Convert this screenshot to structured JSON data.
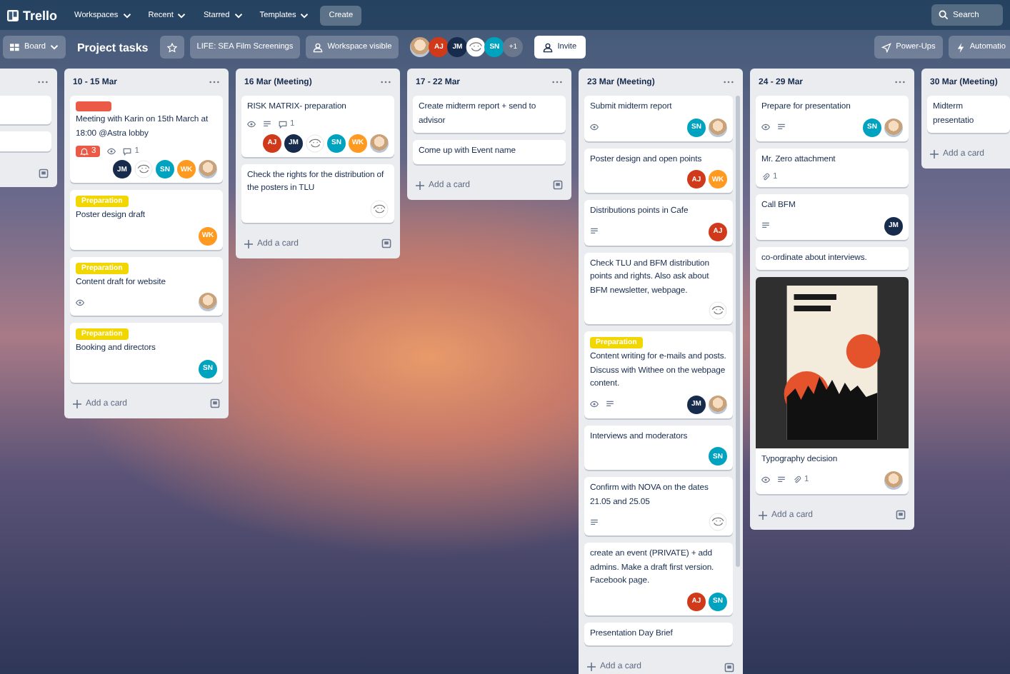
{
  "top_bar": {
    "logo": "Trello",
    "nav": [
      {
        "label": "Workspaces"
      },
      {
        "label": "Recent"
      },
      {
        "label": "Starred"
      },
      {
        "label": "Templates"
      }
    ],
    "create": "Create",
    "search": {
      "placeholder": "Search"
    }
  },
  "board_bar": {
    "view": "Board",
    "title": "Project tasks",
    "starred": false,
    "workspace": "LIFE: SEA Film Screenings",
    "visibility": "Workspace visible",
    "members": [
      {
        "kind": "photo"
      },
      {
        "kind": "initials",
        "text": "AJ",
        "color": "#d0391a"
      },
      {
        "kind": "initials",
        "text": "JM",
        "color": "#172b4d"
      },
      {
        "kind": "sketch"
      },
      {
        "kind": "initials",
        "text": "SN",
        "color": "#00a3bf"
      }
    ],
    "more_members": "+1",
    "invite": "Invite",
    "power_ups": "Power-Ups",
    "automation": "Automatio"
  },
  "lists": [
    {
      "kind": "clipped",
      "scrollable": false,
      "cards": [
        {
          "kind": "blank"
        },
        {
          "kind": "blank"
        }
      ]
    },
    {
      "kind": "full",
      "title": "10 - 15 Mar",
      "scrollable": false,
      "add_card": "Add a card",
      "cards": [
        {
          "kind": "task",
          "labels": [
            {
              "color": "#eb5a46"
            }
          ],
          "title": "Meeting with Karin on 15th March at 18:00 @Astra lobby",
          "badges": [
            {
              "kind": "notifications",
              "text": "3"
            },
            {
              "kind": "watch"
            },
            {
              "kind": "comments",
              "text": "1"
            }
          ],
          "members": [
            {
              "kind": "initials",
              "text": "JM",
              "color": "#172b4d"
            },
            {
              "kind": "sketch"
            },
            {
              "kind": "initials",
              "text": "SN",
              "color": "#00a3bf"
            },
            {
              "kind": "initials",
              "text": "WK",
              "color": "#ff991f"
            },
            {
              "kind": "photo"
            }
          ]
        },
        {
          "kind": "task",
          "labels": [
            {
              "text": "Preparation",
              "color": "#f2d600"
            }
          ],
          "title": "Poster design draft",
          "members": [
            {
              "kind": "initials",
              "text": "WK",
              "color": "#ff991f"
            }
          ]
        },
        {
          "kind": "task",
          "labels": [
            {
              "text": "Preparation",
              "color": "#f2d600"
            }
          ],
          "title": "Content draft for website",
          "badges": [
            {
              "kind": "watch"
            }
          ],
          "members": [
            {
              "kind": "photo"
            }
          ]
        },
        {
          "kind": "task",
          "labels": [
            {
              "text": "Preparation",
              "color": "#f2d600"
            }
          ],
          "title": "Booking and directors",
          "members": [
            {
              "kind": "initials",
              "text": "SN",
              "color": "#00a3bf"
            }
          ]
        }
      ]
    },
    {
      "kind": "full",
      "title": "16 Mar (Meeting)",
      "scrollable": false,
      "add_card": "Add a card",
      "cards": [
        {
          "kind": "task",
          "title": "RISK MATRIX- preparation",
          "badges": [
            {
              "kind": "watch"
            },
            {
              "kind": "description"
            },
            {
              "kind": "comments",
              "text": "1"
            }
          ],
          "members": [
            {
              "kind": "initials",
              "text": "AJ",
              "color": "#d0391a"
            },
            {
              "kind": "initials",
              "text": "JM",
              "color": "#172b4d"
            },
            {
              "kind": "sketch"
            },
            {
              "kind": "initials",
              "text": "SN",
              "color": "#00a3bf"
            },
            {
              "kind": "initials",
              "text": "WK",
              "color": "#ff991f"
            },
            {
              "kind": "photo"
            }
          ]
        },
        {
          "kind": "task",
          "title": "Check the rights for the distribution of the posters in TLU",
          "members": [
            {
              "kind": "sketch"
            }
          ]
        }
      ]
    },
    {
      "kind": "full",
      "title": "17 - 22 Mar",
      "scrollable": false,
      "add_card": "Add a card",
      "cards": [
        {
          "kind": "task",
          "title": "Create midterm report + send to advisor"
        },
        {
          "kind": "task",
          "title": "Come up with Event name"
        }
      ]
    },
    {
      "kind": "full",
      "title": "23 Mar (Meeting)",
      "scrollable": true,
      "add_card": "Add a card",
      "cards": [
        {
          "kind": "task",
          "title": "Submit midterm report",
          "badges": [
            {
              "kind": "watch"
            }
          ],
          "members": [
            {
              "kind": "initials",
              "text": "SN",
              "color": "#00a3bf"
            },
            {
              "kind": "photo"
            }
          ]
        },
        {
          "kind": "task",
          "title": "Poster design and open points",
          "members": [
            {
              "kind": "initials",
              "text": "AJ",
              "color": "#d0391a"
            },
            {
              "kind": "initials",
              "text": "WK",
              "color": "#ff991f"
            }
          ]
        },
        {
          "kind": "task",
          "title": "Distributions points in Cafe",
          "badges": [
            {
              "kind": "description"
            }
          ],
          "members": [
            {
              "kind": "initials",
              "text": "AJ",
              "color": "#d0391a"
            }
          ]
        },
        {
          "kind": "task",
          "title": "Check TLU and BFM distribution points and rights. Also ask about BFM newsletter, webpage.",
          "members": [
            {
              "kind": "sketch"
            }
          ]
        },
        {
          "kind": "task",
          "labels": [
            {
              "text": "Preparation",
              "color": "#f2d600"
            }
          ],
          "title": "Content writing for e-mails and posts. Discuss with Withee on the webpage content.",
          "badges": [
            {
              "kind": "watch"
            },
            {
              "kind": "description"
            }
          ],
          "members": [
            {
              "kind": "initials",
              "text": "JM",
              "color": "#172b4d"
            },
            {
              "kind": "photo"
            }
          ]
        },
        {
          "kind": "task",
          "title": "Interviews and moderators",
          "members": [
            {
              "kind": "initials",
              "text": "SN",
              "color": "#00a3bf"
            }
          ]
        },
        {
          "kind": "task",
          "title": "Confirm with NOVA on the dates 21.05 and 25.05",
          "badges": [
            {
              "kind": "description"
            }
          ],
          "members": [
            {
              "kind": "sketch"
            }
          ]
        },
        {
          "kind": "task",
          "title": "create an event (PRIVATE) + add admins. Make a draft first version. Facebook page.",
          "members": [
            {
              "kind": "initials",
              "text": "AJ",
              "color": "#d0391a"
            },
            {
              "kind": "initials",
              "text": "SN",
              "color": "#00a3bf"
            }
          ]
        },
        {
          "kind": "task",
          "title": "Presentation Day Brief"
        }
      ]
    },
    {
      "kind": "full",
      "title": "24 - 29 Mar",
      "scrollable": false,
      "add_card": "Add a card",
      "cards": [
        {
          "kind": "task",
          "title": "Prepare for presentation",
          "badges": [
            {
              "kind": "watch"
            },
            {
              "kind": "description"
            }
          ],
          "members": [
            {
              "kind": "initials",
              "text": "SN",
              "color": "#00a3bf"
            },
            {
              "kind": "photo"
            }
          ]
        },
        {
          "kind": "task",
          "title": "Mr. Zero attachment",
          "badges": [
            {
              "kind": "attachments",
              "text": "1"
            }
          ]
        },
        {
          "kind": "task",
          "title": "Call BFM",
          "badges": [
            {
              "kind": "description"
            }
          ],
          "members": [
            {
              "kind": "initials",
              "text": "JM",
              "color": "#172b4d"
            }
          ]
        },
        {
          "kind": "task",
          "title": "co-ordinate about interviews."
        },
        {
          "kind": "cover",
          "title": "Typography decision",
          "badges": [
            {
              "kind": "watch"
            },
            {
              "kind": "description"
            },
            {
              "kind": "attachments",
              "text": "1"
            }
          ],
          "members": [
            {
              "kind": "photo"
            }
          ]
        }
      ]
    },
    {
      "kind": "last",
      "title": "30 Mar (Meeting)",
      "scrollable": false,
      "add_card": "Add a card",
      "cards": [
        {
          "kind": "task",
          "title": "Midterm presentatio"
        }
      ]
    }
  ]
}
